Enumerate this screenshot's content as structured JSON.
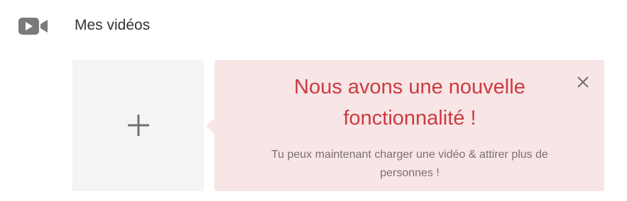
{
  "header": {
    "icon": "video-camera-icon",
    "title": "Mes vidéos"
  },
  "add_tile": {
    "icon": "plus-icon"
  },
  "notice": {
    "title": "Nous avons une nouvelle fonctionnalité !",
    "text": "Tu peux maintenant charger une vidéo & attirer plus de personnes !",
    "close_icon": "close-icon"
  },
  "colors": {
    "icon_gray": "#7a7a7a",
    "notice_bg": "#f8e5e6",
    "notice_title": "#cc3b3f",
    "notice_text": "#7a7070",
    "tile_bg": "#f4f4f4"
  }
}
